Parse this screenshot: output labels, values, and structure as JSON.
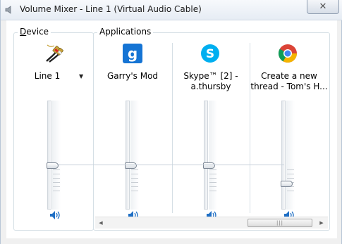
{
  "window": {
    "title": "Volume Mixer - Line 1 (Virtual Audio Cable)",
    "close_glyph": "✕"
  },
  "device": {
    "group_label_accel": "D",
    "group_label_rest": "evice",
    "name": "Line 1",
    "icon": "rca-cable-icon",
    "volume_level": 0.4,
    "muted": false
  },
  "applications": {
    "group_label": "Applications",
    "items": [
      {
        "name": "Garry's Mod",
        "icon": "garrys-mod-icon",
        "volume_level": 0.4,
        "muted": false
      },
      {
        "name": "Skype™ [2] - a.thursby",
        "icon": "skype-icon",
        "volume_level": 0.4,
        "muted": false
      },
      {
        "name": "Create a new thread - Tom's H...",
        "icon": "chrome-icon",
        "volume_level": 0.22,
        "muted": false
      }
    ]
  },
  "scrollbar": {
    "left_arrow": "◀",
    "right_arrow": "▶",
    "grip": "|||"
  },
  "colors": {
    "speaker_blue": "#1f6fc5",
    "garrys_mod_blue": "#1574d4",
    "skype_blue": "#00aff0"
  }
}
